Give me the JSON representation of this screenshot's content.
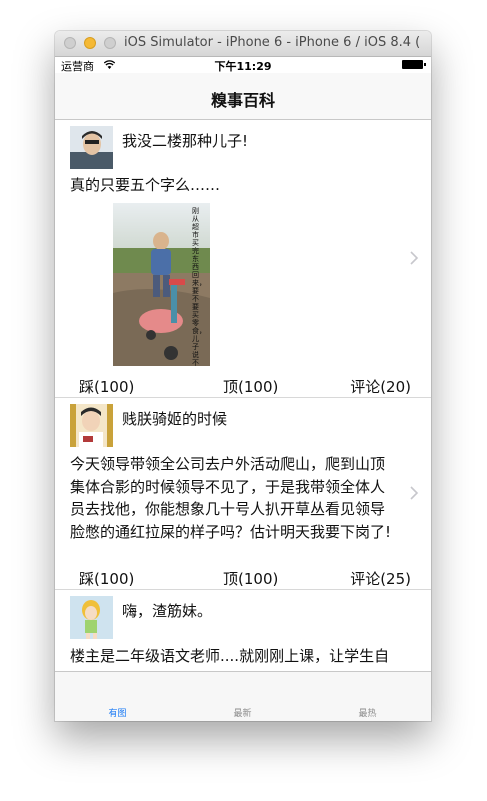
{
  "window": {
    "title": "iOS Simulator - iPhone 6 - iPhone 6 / iOS 8.4 ("
  },
  "status": {
    "carrier": "运营商",
    "time": "下午11:29"
  },
  "nav": {
    "title": "糗事百科"
  },
  "posts": [
    {
      "author": "我没二楼那种儿子!",
      "content": "真的只要五个字么……",
      "image_caption": "刚从超市买完东西回来，要不要买零食，儿子说不想吃",
      "down": "踩(100)",
      "up": "顶(100)",
      "comments": "评论(20)"
    },
    {
      "author": "贱朕骑姬的时候",
      "content": "今天领导带领全公司去户外活动爬山，爬到山顶集体合影的时候领导不见了，于是我带领全体人员去找他，你能想象几十号人扒开草丛看见领导脸憋的通红拉屎的样子吗？估计明天我要下岗了!",
      "down": "踩(100)",
      "up": "顶(100)",
      "comments": "评论(25)"
    },
    {
      "author": "嗨，渣筋妹。",
      "content": "楼主是二年级语文老师....就刚刚上课，让学生自由读课文，下个读的字跳过，然后我就"
    }
  ],
  "tabs": [
    {
      "label": "有图"
    },
    {
      "label": "最新"
    },
    {
      "label": "最热"
    }
  ],
  "colors": {
    "accent": "#1b7bf5",
    "tab_inactive": "#8e8e8e"
  }
}
